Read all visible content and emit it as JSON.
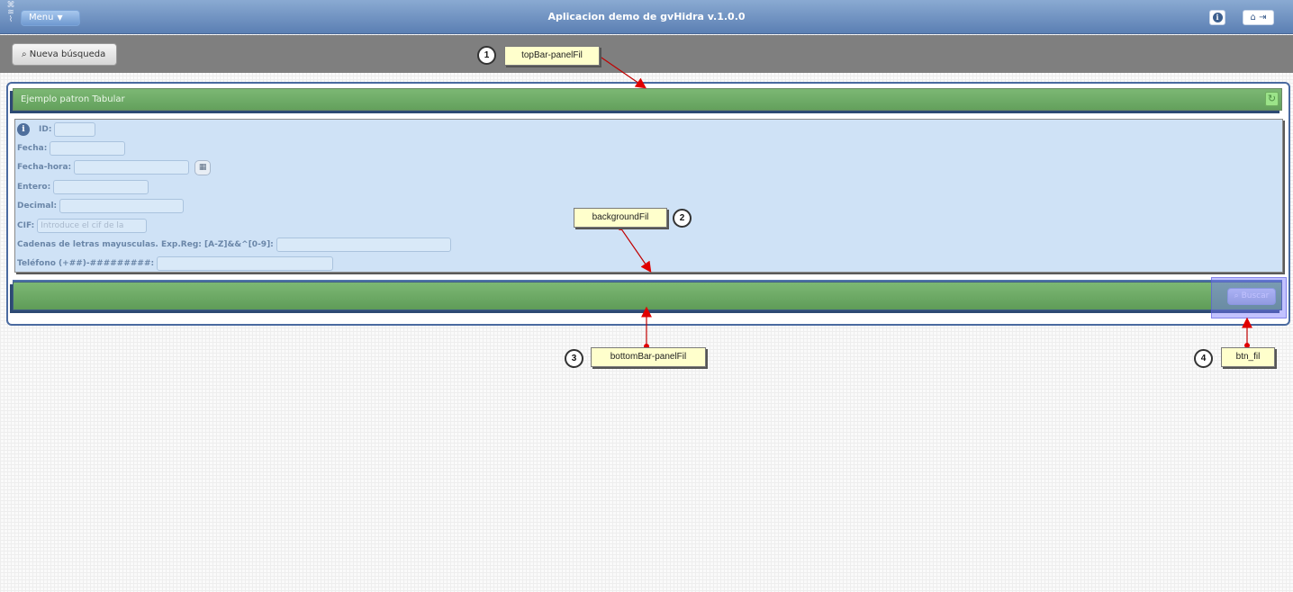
{
  "header": {
    "menu_label": "Menu",
    "title": "Aplicacion demo de gvHidra  v.1.0.0"
  },
  "toolbar": {
    "new_search_label": "Nueva búsqueda"
  },
  "panel": {
    "title": "Ejemplo patron Tabular",
    "search_button_label": "Buscar"
  },
  "filter": {
    "fields": [
      {
        "label": "ID:",
        "value": ""
      },
      {
        "label": "Fecha:",
        "value": ""
      },
      {
        "label": "Fecha-hora:",
        "value": ""
      },
      {
        "label": "Entero:",
        "value": ""
      },
      {
        "label": "Decimal:",
        "value": ""
      },
      {
        "label": "CIF:",
        "value": "",
        "placeholder": "Introduce el cif de la"
      },
      {
        "label": "Cadenas de letras mayusculas. Exp.Reg: [A-Z]&&^[0-9]:",
        "value": ""
      },
      {
        "label": "Teléfono (+##)-#########:",
        "value": ""
      }
    ]
  },
  "annotations": [
    {
      "number": "1",
      "label": "topBar-panelFil"
    },
    {
      "number": "2",
      "label": "backgroundFil"
    },
    {
      "number": "3",
      "label": "bottomBar-panelFil"
    },
    {
      "number": "4",
      "label": "btn_fil"
    }
  ]
}
